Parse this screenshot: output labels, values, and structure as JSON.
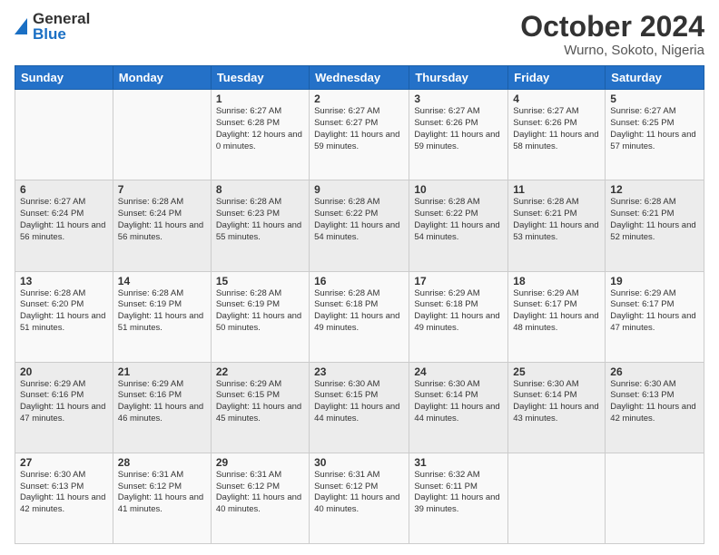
{
  "logo": {
    "line1": "General",
    "line2": "Blue"
  },
  "title": "October 2024",
  "subtitle": "Wurno, Sokoto, Nigeria",
  "days_of_week": [
    "Sunday",
    "Monday",
    "Tuesday",
    "Wednesday",
    "Thursday",
    "Friday",
    "Saturday"
  ],
  "weeks": [
    [
      {
        "day": "",
        "sunrise": "",
        "sunset": "",
        "daylight": ""
      },
      {
        "day": "",
        "sunrise": "",
        "sunset": "",
        "daylight": ""
      },
      {
        "day": "1",
        "sunrise": "Sunrise: 6:27 AM",
        "sunset": "Sunset: 6:28 PM",
        "daylight": "Daylight: 12 hours and 0 minutes."
      },
      {
        "day": "2",
        "sunrise": "Sunrise: 6:27 AM",
        "sunset": "Sunset: 6:27 PM",
        "daylight": "Daylight: 11 hours and 59 minutes."
      },
      {
        "day": "3",
        "sunrise": "Sunrise: 6:27 AM",
        "sunset": "Sunset: 6:26 PM",
        "daylight": "Daylight: 11 hours and 59 minutes."
      },
      {
        "day": "4",
        "sunrise": "Sunrise: 6:27 AM",
        "sunset": "Sunset: 6:26 PM",
        "daylight": "Daylight: 11 hours and 58 minutes."
      },
      {
        "day": "5",
        "sunrise": "Sunrise: 6:27 AM",
        "sunset": "Sunset: 6:25 PM",
        "daylight": "Daylight: 11 hours and 57 minutes."
      }
    ],
    [
      {
        "day": "6",
        "sunrise": "Sunrise: 6:27 AM",
        "sunset": "Sunset: 6:24 PM",
        "daylight": "Daylight: 11 hours and 56 minutes."
      },
      {
        "day": "7",
        "sunrise": "Sunrise: 6:28 AM",
        "sunset": "Sunset: 6:24 PM",
        "daylight": "Daylight: 11 hours and 56 minutes."
      },
      {
        "day": "8",
        "sunrise": "Sunrise: 6:28 AM",
        "sunset": "Sunset: 6:23 PM",
        "daylight": "Daylight: 11 hours and 55 minutes."
      },
      {
        "day": "9",
        "sunrise": "Sunrise: 6:28 AM",
        "sunset": "Sunset: 6:22 PM",
        "daylight": "Daylight: 11 hours and 54 minutes."
      },
      {
        "day": "10",
        "sunrise": "Sunrise: 6:28 AM",
        "sunset": "Sunset: 6:22 PM",
        "daylight": "Daylight: 11 hours and 54 minutes."
      },
      {
        "day": "11",
        "sunrise": "Sunrise: 6:28 AM",
        "sunset": "Sunset: 6:21 PM",
        "daylight": "Daylight: 11 hours and 53 minutes."
      },
      {
        "day": "12",
        "sunrise": "Sunrise: 6:28 AM",
        "sunset": "Sunset: 6:21 PM",
        "daylight": "Daylight: 11 hours and 52 minutes."
      }
    ],
    [
      {
        "day": "13",
        "sunrise": "Sunrise: 6:28 AM",
        "sunset": "Sunset: 6:20 PM",
        "daylight": "Daylight: 11 hours and 51 minutes."
      },
      {
        "day": "14",
        "sunrise": "Sunrise: 6:28 AM",
        "sunset": "Sunset: 6:19 PM",
        "daylight": "Daylight: 11 hours and 51 minutes."
      },
      {
        "day": "15",
        "sunrise": "Sunrise: 6:28 AM",
        "sunset": "Sunset: 6:19 PM",
        "daylight": "Daylight: 11 hours and 50 minutes."
      },
      {
        "day": "16",
        "sunrise": "Sunrise: 6:28 AM",
        "sunset": "Sunset: 6:18 PM",
        "daylight": "Daylight: 11 hours and 49 minutes."
      },
      {
        "day": "17",
        "sunrise": "Sunrise: 6:29 AM",
        "sunset": "Sunset: 6:18 PM",
        "daylight": "Daylight: 11 hours and 49 minutes."
      },
      {
        "day": "18",
        "sunrise": "Sunrise: 6:29 AM",
        "sunset": "Sunset: 6:17 PM",
        "daylight": "Daylight: 11 hours and 48 minutes."
      },
      {
        "day": "19",
        "sunrise": "Sunrise: 6:29 AM",
        "sunset": "Sunset: 6:17 PM",
        "daylight": "Daylight: 11 hours and 47 minutes."
      }
    ],
    [
      {
        "day": "20",
        "sunrise": "Sunrise: 6:29 AM",
        "sunset": "Sunset: 6:16 PM",
        "daylight": "Daylight: 11 hours and 47 minutes."
      },
      {
        "day": "21",
        "sunrise": "Sunrise: 6:29 AM",
        "sunset": "Sunset: 6:16 PM",
        "daylight": "Daylight: 11 hours and 46 minutes."
      },
      {
        "day": "22",
        "sunrise": "Sunrise: 6:29 AM",
        "sunset": "Sunset: 6:15 PM",
        "daylight": "Daylight: 11 hours and 45 minutes."
      },
      {
        "day": "23",
        "sunrise": "Sunrise: 6:30 AM",
        "sunset": "Sunset: 6:15 PM",
        "daylight": "Daylight: 11 hours and 44 minutes."
      },
      {
        "day": "24",
        "sunrise": "Sunrise: 6:30 AM",
        "sunset": "Sunset: 6:14 PM",
        "daylight": "Daylight: 11 hours and 44 minutes."
      },
      {
        "day": "25",
        "sunrise": "Sunrise: 6:30 AM",
        "sunset": "Sunset: 6:14 PM",
        "daylight": "Daylight: 11 hours and 43 minutes."
      },
      {
        "day": "26",
        "sunrise": "Sunrise: 6:30 AM",
        "sunset": "Sunset: 6:13 PM",
        "daylight": "Daylight: 11 hours and 42 minutes."
      }
    ],
    [
      {
        "day": "27",
        "sunrise": "Sunrise: 6:30 AM",
        "sunset": "Sunset: 6:13 PM",
        "daylight": "Daylight: 11 hours and 42 minutes."
      },
      {
        "day": "28",
        "sunrise": "Sunrise: 6:31 AM",
        "sunset": "Sunset: 6:12 PM",
        "daylight": "Daylight: 11 hours and 41 minutes."
      },
      {
        "day": "29",
        "sunrise": "Sunrise: 6:31 AM",
        "sunset": "Sunset: 6:12 PM",
        "daylight": "Daylight: 11 hours and 40 minutes."
      },
      {
        "day": "30",
        "sunrise": "Sunrise: 6:31 AM",
        "sunset": "Sunset: 6:12 PM",
        "daylight": "Daylight: 11 hours and 40 minutes."
      },
      {
        "day": "31",
        "sunrise": "Sunrise: 6:32 AM",
        "sunset": "Sunset: 6:11 PM",
        "daylight": "Daylight: 11 hours and 39 minutes."
      },
      {
        "day": "",
        "sunrise": "",
        "sunset": "",
        "daylight": ""
      },
      {
        "day": "",
        "sunrise": "",
        "sunset": "",
        "daylight": ""
      }
    ]
  ]
}
